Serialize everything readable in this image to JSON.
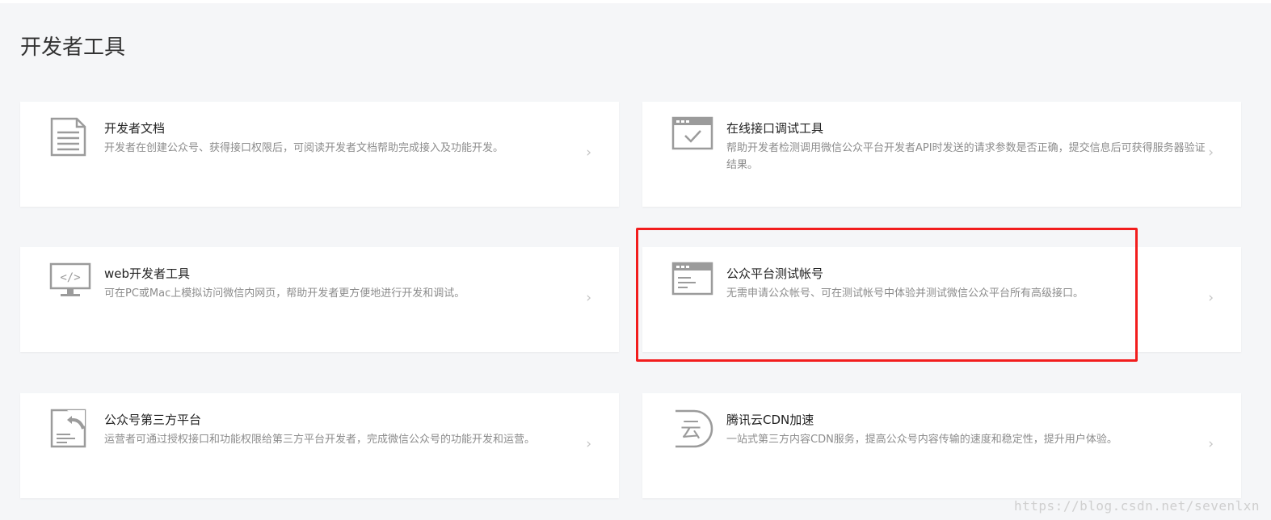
{
  "page": {
    "title": "开发者工具"
  },
  "cards": [
    {
      "title": "开发者文档",
      "desc": "开发者在创建公众号、获得接口权限后，可阅读开发者文档帮助完成接入及功能开发。",
      "icon": "document-icon"
    },
    {
      "title": "在线接口调试工具",
      "desc": "帮助开发者检测调用微信公众平台开发者API时发送的请求参数是否正确，提交信息后可获得服务器验证结果。",
      "icon": "browser-check-icon"
    },
    {
      "title": "web开发者工具",
      "desc": "可在PC或Mac上模拟访问微信内网页，帮助开发者更方便地进行开发和调试。",
      "icon": "monitor-code-icon"
    },
    {
      "title": "公众平台测试帐号",
      "desc": "无需申请公众帐号、可在测试帐号中体验并测试微信公众平台所有高级接口。",
      "icon": "browser-window-icon"
    },
    {
      "title": "公众号第三方平台",
      "desc": "运营者可通过授权接口和功能权限给第三方平台开发者，完成微信公众号的功能开发和运营。",
      "icon": "share-document-icon"
    },
    {
      "title": "腾讯云CDN加速",
      "desc": "一站式第三方内容CDN服务，提高公众号内容传输的速度和稳定性，提升用户体验。",
      "icon": "cloud-yun-icon"
    }
  ],
  "chevron": "›",
  "icon_glyph": {
    "cloud_char": "云",
    "code_tag": "</>"
  },
  "highlight": {
    "color": "#f21d1d",
    "target_card": "公众平台测试帐号"
  },
  "watermark": "https://blog.csdn.net/sevenlxn"
}
